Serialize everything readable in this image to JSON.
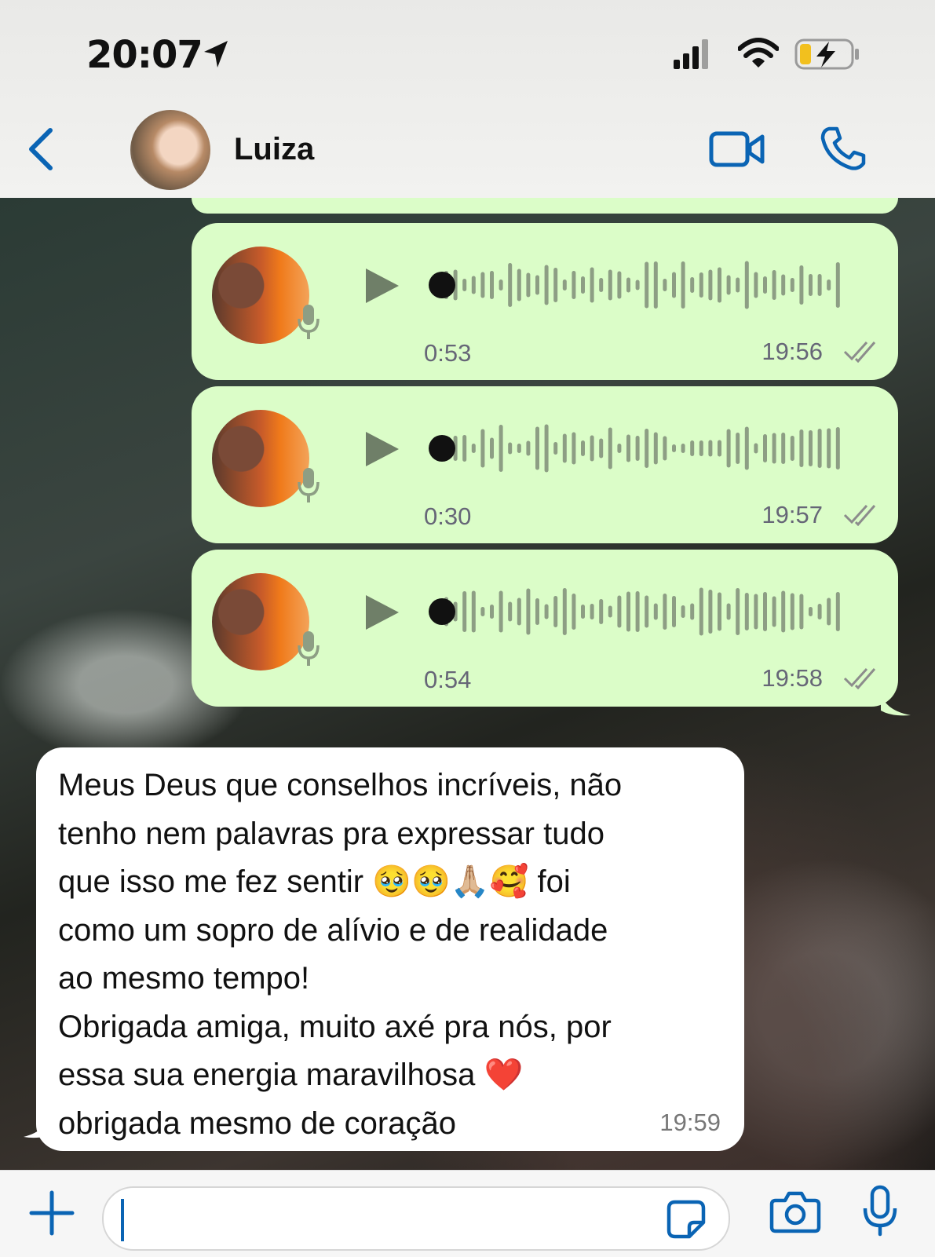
{
  "status_bar": {
    "time": "20:07"
  },
  "header": {
    "contact_name": "Luiza"
  },
  "voice_messages": [
    {
      "duration": "0:53",
      "time": "19:56"
    },
    {
      "duration": "0:30",
      "time": "19:57"
    },
    {
      "duration": "0:54",
      "time": "19:58"
    }
  ],
  "incoming": {
    "text": "Meus Deus que conselhos incríveis, não\ntenho nem palavras pra expressar tudo\nque isso me fez sentir 🥹🥹🙏🏼🥰 foi\ncomo um sopro de alívio e de realidade\nao mesmo tempo!\nObrigada amiga, muito axé pra nós, por\nessa sua energia maravilhosa ❤️\nobrigada mesmo de coração",
    "time": "19:59"
  },
  "colors": {
    "accent": "#0a64b4",
    "outgoing_bubble": "#dbfdc8",
    "incoming_bubble": "#ffffff",
    "waveform": "#8d9e84"
  },
  "icons": [
    "location-arrow-icon",
    "signal-icon",
    "wifi-icon",
    "battery-charging-icon",
    "back-chevron-icon",
    "video-call-icon",
    "phone-icon",
    "play-icon",
    "mic-icon",
    "double-check-icon",
    "plus-icon",
    "sticker-icon",
    "camera-icon"
  ]
}
